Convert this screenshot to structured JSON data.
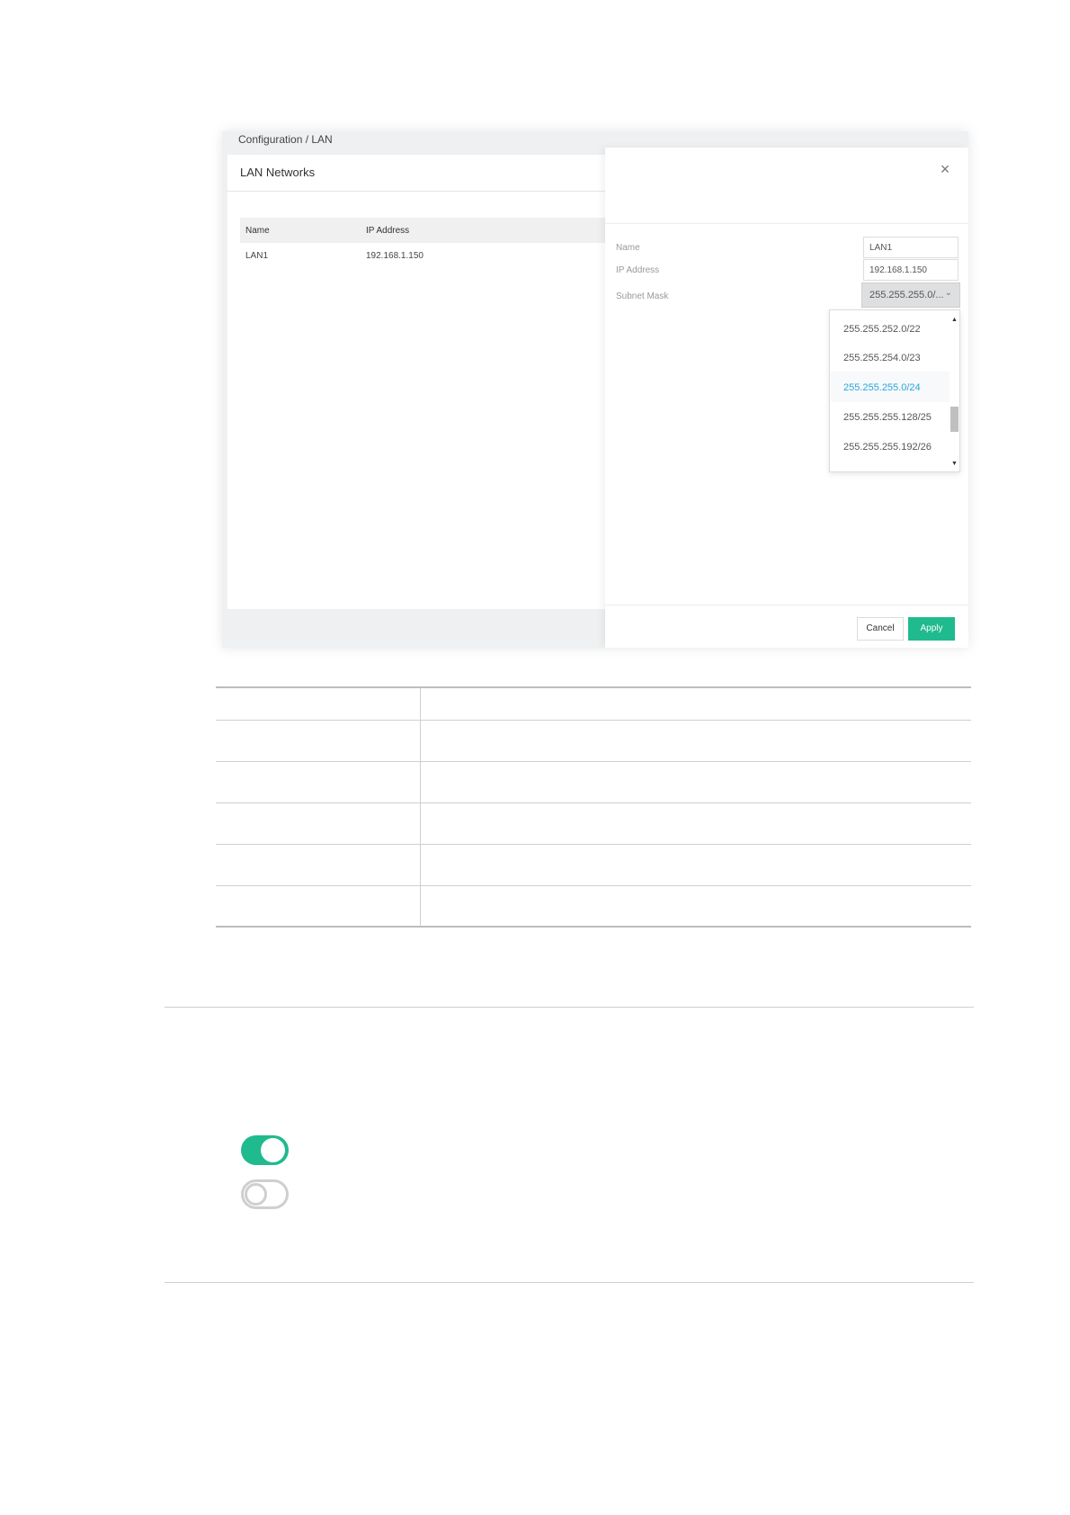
{
  "breadcrumb": "Configuration / LAN",
  "card": {
    "title": "LAN Networks",
    "columns": [
      "Name",
      "IP Address"
    ],
    "rows": [
      {
        "name": "LAN1",
        "ip": "192.168.1.150"
      }
    ]
  },
  "panel": {
    "close_icon": "×",
    "name_label": "Name",
    "name_value": "LAN1",
    "ip_label": "IP Address",
    "ip_value": "192.168.1.150",
    "mask_label": "Subnet Mask",
    "mask_value": "255.255.255.0/...",
    "chevron": "⌄",
    "options": [
      {
        "label": "255.255.252.0/22",
        "selected": false
      },
      {
        "label": "255.255.254.0/23",
        "selected": false
      },
      {
        "label": "255.255.255.0/24",
        "selected": true
      },
      {
        "label": "255.255.255.128/25",
        "selected": false
      },
      {
        "label": "255.255.255.192/26",
        "selected": false
      }
    ],
    "scroll_up": "▲",
    "scroll_down": "▼",
    "cancel_label": "Cancel",
    "apply_label": "Apply"
  },
  "toggles": {
    "on_state": true,
    "off_state": false
  },
  "colors": {
    "accent": "#1fba8e",
    "link": "#2aa6de"
  }
}
